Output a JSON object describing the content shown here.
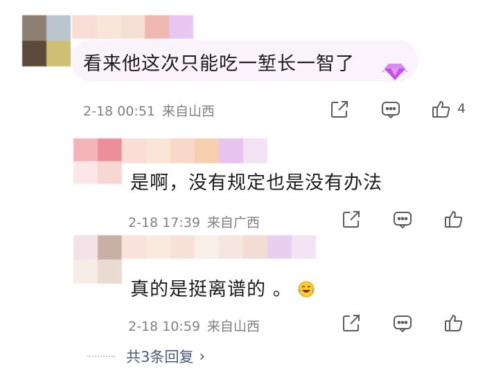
{
  "comments": [
    {
      "text": "看来他这次只能吃一堑长一智了",
      "time": "2-18 00:51",
      "location": "来自山西",
      "badge": "gem-icon",
      "like_count": "4"
    },
    {
      "text": "是啊，没有规定也是没有办法",
      "time": "2-18 17:39",
      "location": "来自广西"
    },
    {
      "text": "真的是挺离谱的 。",
      "time": "2-18 10:59",
      "location": "来自山西",
      "emoji": "laughing-tears-emoji"
    }
  ],
  "replies_label": "共3条回复",
  "colors": {
    "bubble": "#fbf5fb",
    "meta_text": "#808080",
    "reply_link": "#4a5a7a",
    "icon_stroke": "#5a5a5a",
    "gem": "#c44fe0"
  }
}
